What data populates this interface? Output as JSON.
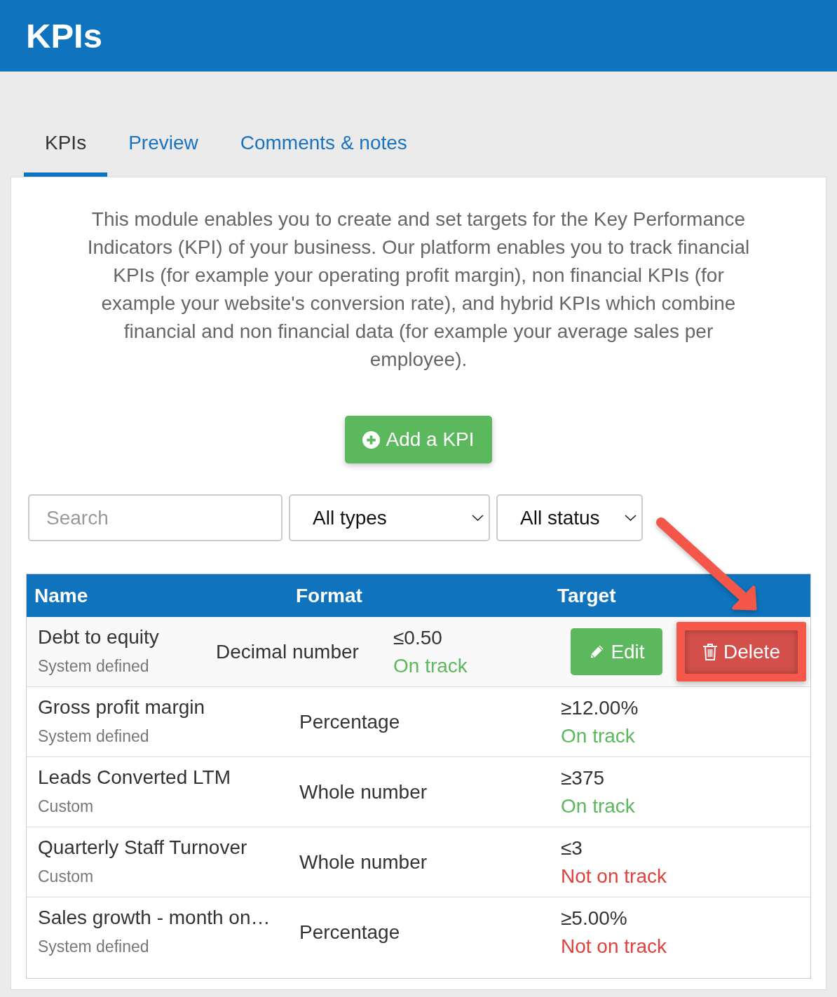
{
  "header": {
    "title": "KPIs"
  },
  "tabs": [
    {
      "label": "KPIs",
      "selected": true
    },
    {
      "label": "Preview",
      "selected": false
    },
    {
      "label": "Comments & notes",
      "selected": false
    }
  ],
  "description": "This module enables you to create and set targets for the Key Performance Indicators (KPI) of your business. Our platform enables you to track financial KPIs (for example your operating profit margin), non financial KPIs (for example your website's conversion rate), and hybrid KPIs which combine financial and non financial data (for example your average sales per employee).",
  "add_button": {
    "label": "Add a KPI"
  },
  "filters": {
    "search": {
      "placeholder": "Search"
    },
    "selects": [
      {
        "value": "All types"
      },
      {
        "value": "All status"
      }
    ]
  },
  "table": {
    "columns": [
      "Name",
      "Format",
      "Target"
    ],
    "hovered_row": {
      "name": "Debt to equity",
      "source": "System defined",
      "format": "Decimal number",
      "target": "≤0.50",
      "status": "On track",
      "on_track": true,
      "actions": [
        {
          "kind": "edit",
          "label": "Edit",
          "highlighted": false
        },
        {
          "kind": "delete",
          "label": "Delete",
          "highlighted": true
        }
      ]
    },
    "rows": [
      {
        "name": "Gross profit margin",
        "source": "System defined",
        "format": "Percentage",
        "target": "≥12.00%",
        "status": "On track",
        "on_track": true,
        "hovered": false
      },
      {
        "name": "Leads Converted LTM",
        "source": "Custom",
        "format": "Whole number",
        "target": "≥375",
        "status": "On track",
        "on_track": true,
        "hovered": false
      },
      {
        "name": "Quarterly Staff Turnover",
        "source": "Custom",
        "format": "Whole number",
        "target": "≤3",
        "status": "Not on track",
        "on_track": false,
        "hovered": false
      },
      {
        "name": "Sales growth - month on…",
        "source": "System defined",
        "format": "Percentage",
        "target": "≥5.00%",
        "status": "Not on track",
        "on_track": false,
        "hovered": false
      }
    ]
  },
  "annotation_arrow": true
}
